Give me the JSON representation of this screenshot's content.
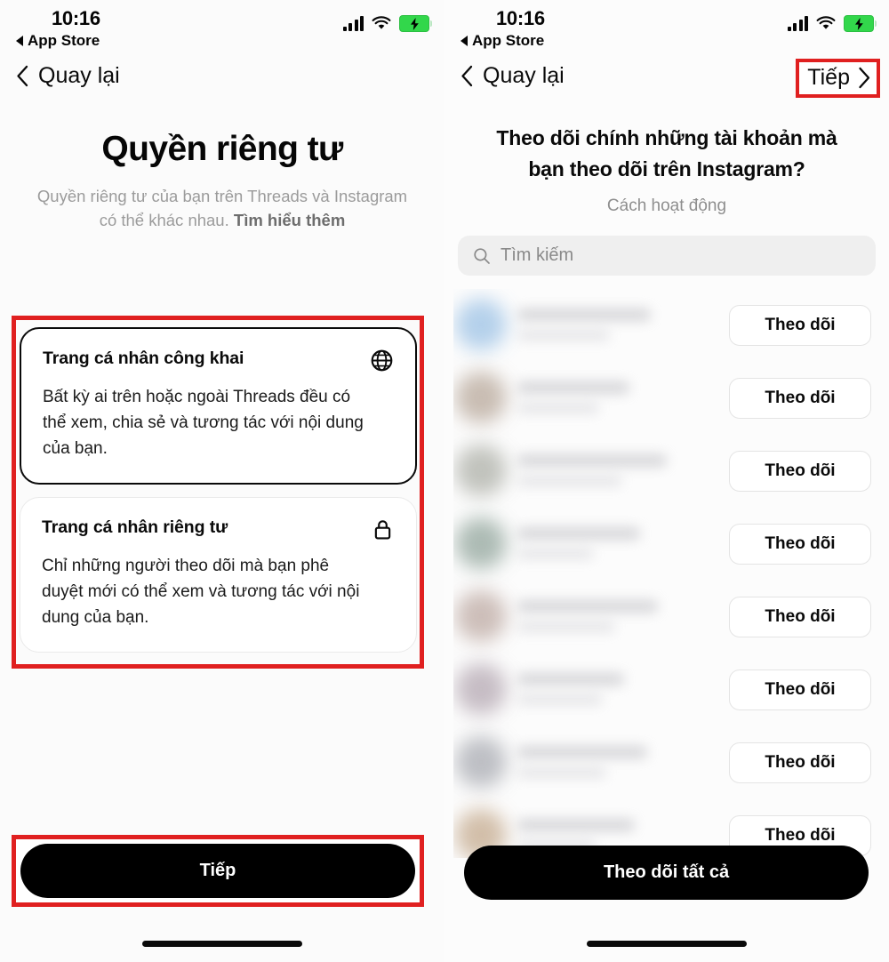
{
  "status_bar": {
    "time": "10:16",
    "back_app": "App Store",
    "signal_icon": "cellular-signal-icon",
    "wifi_icon": "wifi-icon",
    "battery_icon": "battery-charging-icon",
    "battery_color": "#32d74b"
  },
  "left_screen": {
    "nav": {
      "back_label": "Quay lại",
      "back_icon": "chevron-left-icon"
    },
    "title": "Quyền riêng tư",
    "subtitle_text": "Quyền riêng tư của bạn trên Threads và Instagram có thể khác nhau. ",
    "subtitle_link": "Tìm hiểu thêm",
    "options": [
      {
        "title": "Trang cá nhân công khai",
        "description": "Bất kỳ ai trên hoặc ngoài Threads đều có thể xem, chia sẻ và tương tác với nội dung của bạn.",
        "icon": "globe-icon",
        "selected": true
      },
      {
        "title": "Trang cá nhân riêng tư",
        "description": "Chỉ những người theo dõi mà bạn phê duyệt mới có thể xem và tương tác với nội dung của bạn.",
        "icon": "lock-icon",
        "selected": false
      }
    ],
    "cta_label": "Tiếp"
  },
  "right_screen": {
    "nav": {
      "back_label": "Quay lại",
      "back_icon": "chevron-left-icon",
      "next_label": "Tiếp",
      "next_icon": "chevron-right-icon"
    },
    "title": "Theo dõi chính những tài khoản mà bạn theo dõi trên Instagram?",
    "subtitle": "Cách hoạt động",
    "search": {
      "placeholder": "Tìm kiếm",
      "icon": "search-icon",
      "value": ""
    },
    "follow_button_label": "Theo dõi",
    "rows": [
      {
        "follow_label": "Theo dõi",
        "avatar_color": "#a8c9e8",
        "name_w": 150,
        "handle_w": 104
      },
      {
        "follow_label": "Theo dõi",
        "avatar_color": "#c0b2a6",
        "name_w": 126,
        "handle_w": 92
      },
      {
        "follow_label": "Theo dõi",
        "avatar_color": "#b7b9b2",
        "name_w": 168,
        "handle_w": 118
      },
      {
        "follow_label": "Theo dõi",
        "avatar_color": "#9fb0a8",
        "name_w": 138,
        "handle_w": 86
      },
      {
        "follow_label": "Theo dõi",
        "avatar_color": "#c5b4ae",
        "name_w": 158,
        "handle_w": 110
      },
      {
        "follow_label": "Theo dõi",
        "avatar_color": "#bdb2bb",
        "name_w": 120,
        "handle_w": 96
      },
      {
        "follow_label": "Theo dõi",
        "avatar_color": "#b3b5bb",
        "name_w": 146,
        "handle_w": 100
      },
      {
        "follow_label": "Theo dõi",
        "avatar_color": "#cbb49b",
        "name_w": 132,
        "handle_w": 88
      }
    ],
    "cta_label": "Theo dõi tất cả"
  },
  "annotations": {
    "highlight_color": "#e02020"
  }
}
